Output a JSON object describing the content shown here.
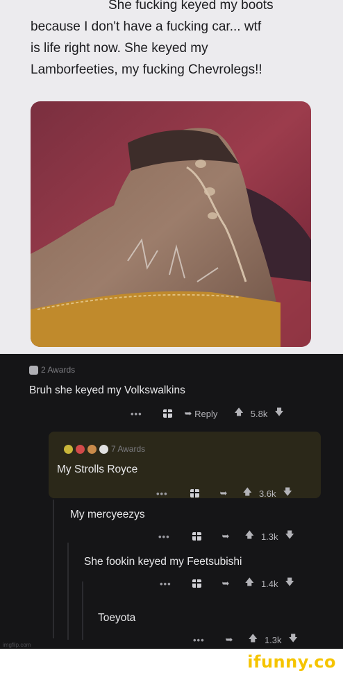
{
  "tweet": {
    "lines": [
      "She fucking keyed my boots",
      "because I don't have a fucking car... wtf",
      "is life right now. She keyed my",
      "Lamborfeeties, my fucking Chevrolegs!!"
    ]
  },
  "comments": [
    {
      "awards": "2 Awards",
      "text": "Bruh she keyed my Volkswalkins",
      "reply": "Reply",
      "votes": "5.8k"
    },
    {
      "awards": "7 Awards",
      "text": "My Strolls Royce",
      "votes": "3.6k"
    },
    {
      "text": "My mercyeezys",
      "votes": "1.3k"
    },
    {
      "text": "She fookin keyed my Feetsubishi",
      "votes": "1.4k"
    },
    {
      "text": "Toeyota",
      "votes": "1.3k"
    }
  ],
  "actions": {
    "more": "•••"
  },
  "watermarks": {
    "imgflip": "imgflip.com",
    "ifunny": "ifunny.co"
  },
  "colors": {
    "accent": "#f5c400",
    "highlight": "#2b2819",
    "background": "#151517"
  }
}
